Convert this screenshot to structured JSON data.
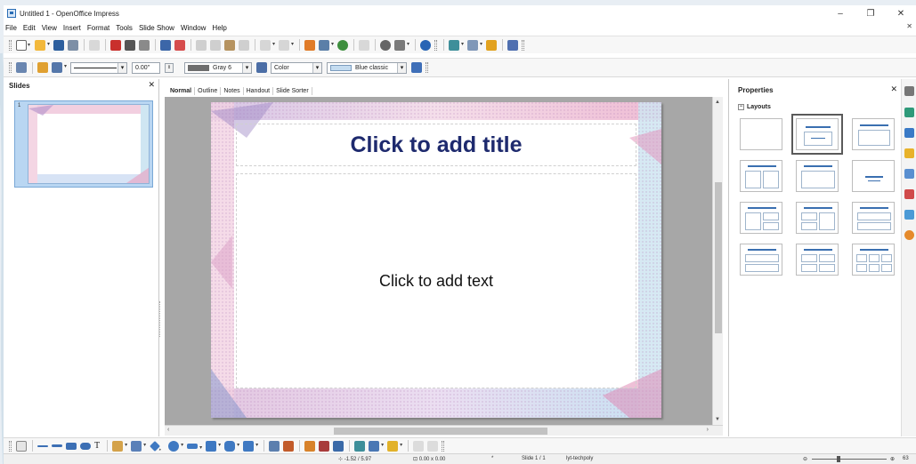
{
  "window": {
    "title": "Untitled 1 - OpenOffice Impress",
    "minimize": "–",
    "maximize": "❐",
    "close": "✕"
  },
  "menu": {
    "items": [
      "File",
      "Edit",
      "View",
      "Insert",
      "Format",
      "Tools",
      "Slide Show",
      "Window",
      "Help"
    ],
    "close": "✕"
  },
  "toolbar2": {
    "line_width": "0.00\"",
    "line_color": "Gray 6",
    "area_style": "Color",
    "area_color": "Blue classic"
  },
  "slides_pane": {
    "title": "Slides",
    "close": "✕",
    "slide_number": "1"
  },
  "view_tabs": [
    "Normal",
    "Outline",
    "Notes",
    "Handout",
    "Slide Sorter"
  ],
  "slide": {
    "title_placeholder": "Click to add title",
    "text_placeholder": "Click to add text"
  },
  "properties": {
    "title": "Properties",
    "close": "✕",
    "section": "Layouts",
    "collapse": "−"
  },
  "status": {
    "position": "-1.52 / 5.97",
    "size": "0.00 x 0.00",
    "slide": "Slide 1 / 1",
    "master": "lyt-techpoly",
    "zoom": "63"
  },
  "colors": {
    "title_text": "#1e2a6e",
    "accent": "#3a6fb0",
    "slide_pink": "#e7a6c6",
    "slide_blue": "#a9d3ea"
  }
}
